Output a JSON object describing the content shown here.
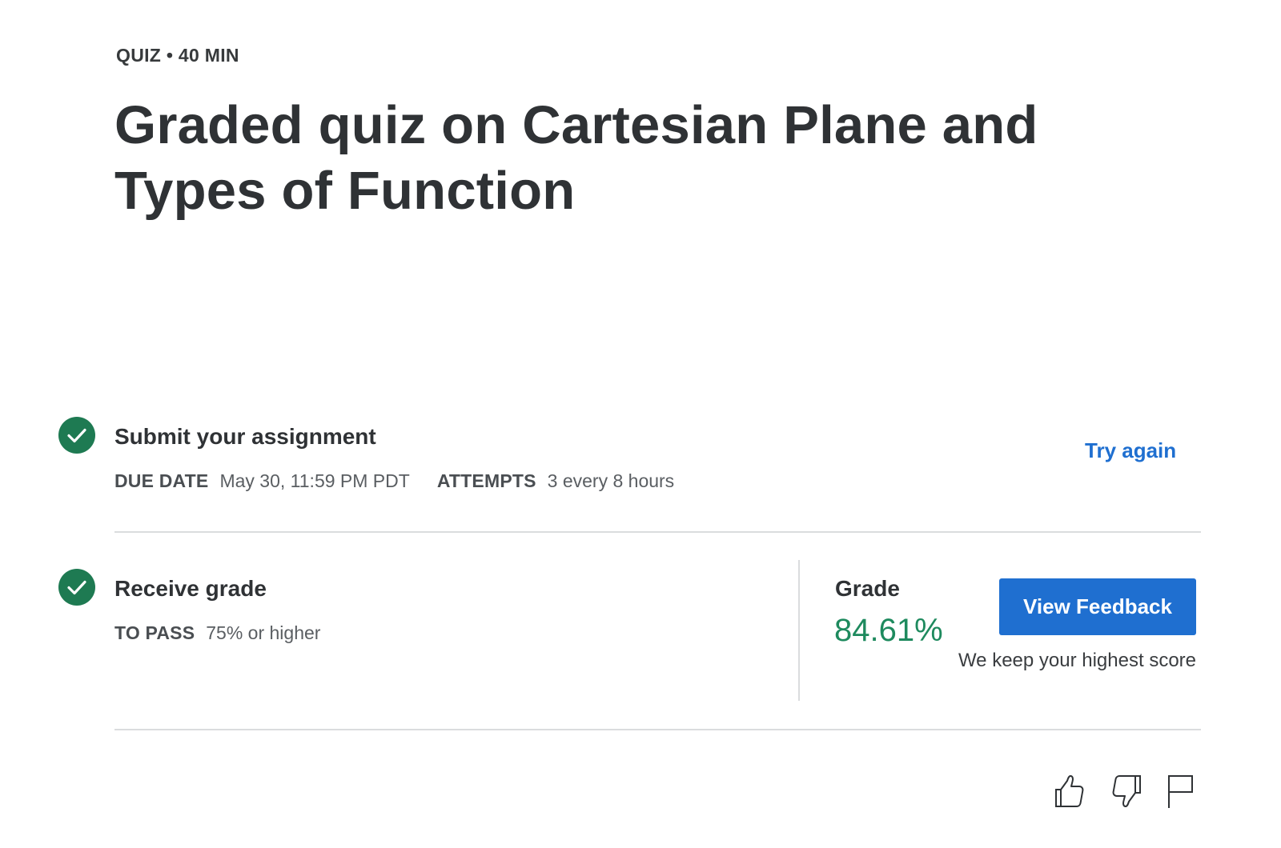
{
  "header": {
    "meta": "QUIZ • 40 MIN",
    "title": "Graded quiz on Cartesian Plane and Types of Function"
  },
  "submit_step": {
    "title": "Submit your assignment",
    "due_label": "DUE DATE",
    "due_value": "May 30, 11:59 PM PDT",
    "attempts_label": "ATTEMPTS",
    "attempts_value": "3 every 8 hours",
    "try_again_label": "Try again",
    "icon": "check-circle-icon"
  },
  "grade_step": {
    "title": "Receive grade",
    "pass_label": "TO PASS",
    "pass_value": "75% or higher",
    "grade_label": "Grade",
    "grade_value": "84.61%",
    "view_feedback_label": "View Feedback",
    "keep_note": "We keep your highest score",
    "icon": "check-circle-icon"
  },
  "actions": {
    "like_icon": "thumbs-up-icon",
    "dislike_icon": "thumbs-down-icon",
    "report_icon": "flag-icon"
  },
  "colors": {
    "success": "#1e7a52",
    "grade_text": "#1e8a5e",
    "primary": "#1f6fd0",
    "text": "#373a3c"
  }
}
